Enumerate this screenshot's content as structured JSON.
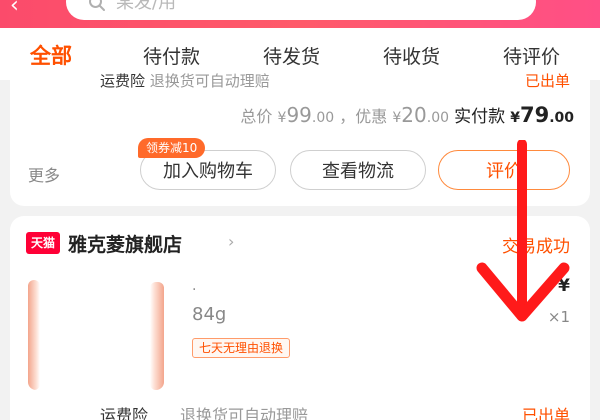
{
  "header": {
    "back_symbol": "‹",
    "search_placeholder": "某发/用"
  },
  "tabs": [
    {
      "label": "全部",
      "active": true
    },
    {
      "label": "待付款",
      "active": false
    },
    {
      "label": "待发货",
      "active": false
    },
    {
      "label": "待收货",
      "active": false
    },
    {
      "label": "待评价",
      "active": false
    }
  ],
  "order1": {
    "insurance_label": "运费险",
    "insurance_text": "退换货可自动理赔",
    "insurance_status": "已出单",
    "total_label": "总价",
    "total_currency": "¥",
    "total_int": "99",
    "total_dec": ".00",
    "discount_label": "，优惠",
    "discount_currency": "¥",
    "discount_int": "20",
    "discount_dec": ".00",
    "paid_label": "实付款",
    "paid_currency": "¥",
    "paid_int": "79",
    "paid_dec": ".00",
    "more_label": "更多",
    "coupon_badge": "领券减10",
    "add_cart_label": "加入购物车",
    "logistics_label": "查看物流",
    "review_label": "评价"
  },
  "order2": {
    "platform_badge": "天猫",
    "store_name": "雅克菱旗舰店",
    "chevron": "›",
    "trade_status": "交易成功",
    "spec_line1": "·",
    "spec_weight": "84g",
    "return_tag": "七天无理由退换",
    "item_price": "¥",
    "item_qty": "×1",
    "insurance_label": "运费险",
    "insurance_text": "退换货可自动理赔",
    "insurance_status": "已出单"
  },
  "colors": {
    "header_pink": "#ff4f86",
    "accent_orange": "#ff5000",
    "arrow_red": "#ff1a1a",
    "tmall_red": "#ff0036"
  },
  "icons": [
    "back-arrow-icon",
    "search-icon",
    "chevron-right-icon",
    "tmall-icon",
    "down-arrow-icon"
  ]
}
